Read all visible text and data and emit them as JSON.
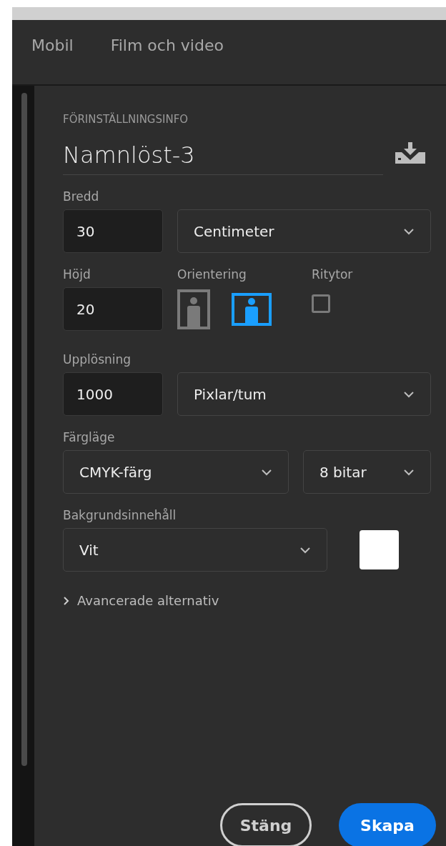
{
  "tabs": [
    {
      "label": "Mobil",
      "selected": false
    },
    {
      "label": "Film och video",
      "selected": false
    }
  ],
  "preset": {
    "heading": "FÖRINSTÄLLNINGSINFO",
    "name": "Namnlöst-3"
  },
  "width": {
    "label": "Bredd",
    "value": "30",
    "unit": "Centimeter"
  },
  "height": {
    "label": "Höjd",
    "value": "20"
  },
  "orientation": {
    "label": "Orientering",
    "options": [
      {
        "kind": "portrait",
        "selected": false
      },
      {
        "kind": "landscape",
        "selected": true
      }
    ]
  },
  "artboards": {
    "label": "Ritytor",
    "checked": false
  },
  "resolution": {
    "label": "Upplösning",
    "value": "1000",
    "unit": "Pixlar/tum"
  },
  "color_mode": {
    "label": "Färgläge",
    "mode": "CMYK-färg",
    "depth": "8 bitar"
  },
  "background": {
    "label": "Bakgrundsinnehåll",
    "value": "Vit"
  },
  "advanced": {
    "label": "Avancerade alternativ",
    "expanded": false
  },
  "buttons": [
    {
      "kind": "secondary",
      "label": "Stäng"
    },
    {
      "kind": "primary",
      "label": "Skapa"
    }
  ]
}
